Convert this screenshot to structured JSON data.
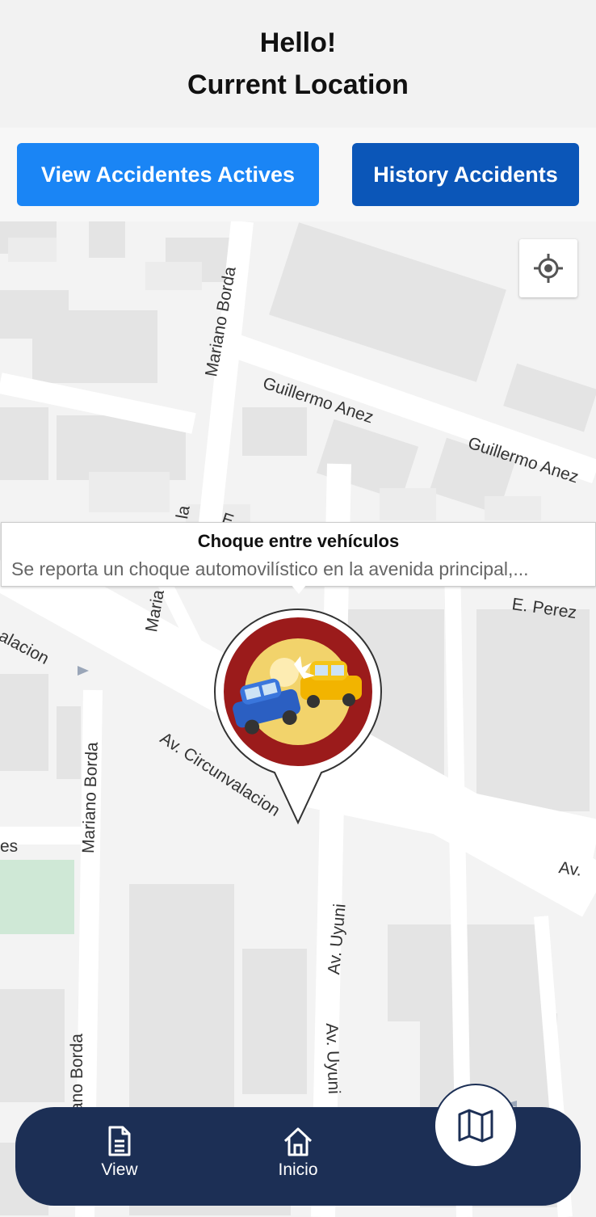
{
  "header": {
    "line1": "Hello!",
    "line2": "Current Location"
  },
  "buttons": {
    "active_label": "View Accidentes Actives",
    "history_label": "History Accidents"
  },
  "map": {
    "streets": {
      "mariano_borda_top": "Mariano Borda",
      "guillermo_anez_1": "Guillermo Anez",
      "guillermo_anez_2": "Guillermo Anez",
      "la_partial": "la",
      "e_partial": "E.",
      "maria_partial": "Maria",
      "e_perez": "E. Perez",
      "circunvalacion_left": "alacion",
      "circunvalacion_main": "Av. Circunvalacion",
      "mariano_borda_mid": "Mariano Borda",
      "es_partial": "es",
      "av_right": "Av.",
      "av_uyuni_1": "Av. Uyuni",
      "av_uyuni_2": "Av. Uyuni",
      "mariano_borda_bottom": "ano Borda"
    },
    "popup": {
      "title": "Choque entre vehículos",
      "description": "Se reporta un choque automovilístico en la avenida principal,..."
    },
    "locate_icon": "my-location-icon",
    "marker_icon": "car-crash-icon"
  },
  "nav": {
    "view_label": "View",
    "inicio_label": "Inicio",
    "view_icon": "document-icon",
    "inicio_icon": "home-icon",
    "map_icon": "map-icon"
  },
  "colors": {
    "primary_button": "#1a85f5",
    "secondary_button": "#0b56b8",
    "navbar": "#1c2f55",
    "marker_red": "#9b1b1b",
    "marker_yellow": "#f2d36b"
  }
}
